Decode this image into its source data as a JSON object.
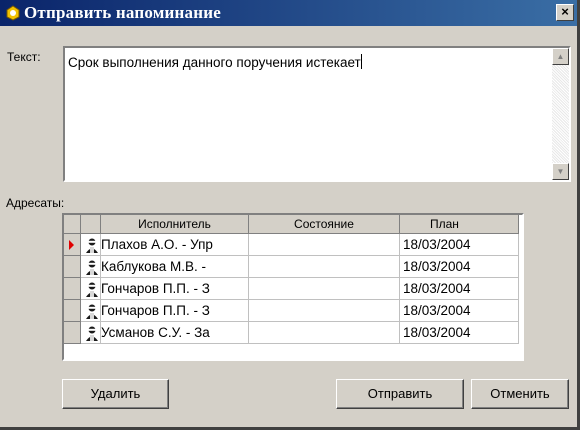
{
  "window": {
    "title": "Отправить напоминание",
    "close_label": "×"
  },
  "text_label": "Текст:",
  "message": "Срок выполнения данного поручения истекает",
  "recipients_label": "Адресаты:",
  "grid": {
    "headers": {
      "executor": "Исполнитель",
      "state": "Состояние",
      "plan": "План"
    },
    "rows": [
      {
        "executor": "Плахов А.О. - Упр",
        "state": "",
        "plan": "18/03/2004",
        "current": true
      },
      {
        "executor": "Каблукова М.В. -",
        "state": "",
        "plan": "18/03/2004"
      },
      {
        "executor": "Гончаров П.П. - З",
        "state": "",
        "plan": "18/03/2004"
      },
      {
        "executor": "Гончаров П.П. - З",
        "state": "",
        "plan": "18/03/2004"
      },
      {
        "executor": "Усманов С.У. - За",
        "state": "",
        "plan": "18/03/2004"
      }
    ]
  },
  "buttons": {
    "delete": "Удалить",
    "send": "Отправить",
    "cancel": "Отменить"
  },
  "icons": {
    "title": "app-icon",
    "person": "person-icon",
    "row_pointer": "current-row-pointer-icon"
  },
  "colors": {
    "titlebar": "#0a246a",
    "face": "#d4d0c8",
    "pointer": "#e00000"
  }
}
